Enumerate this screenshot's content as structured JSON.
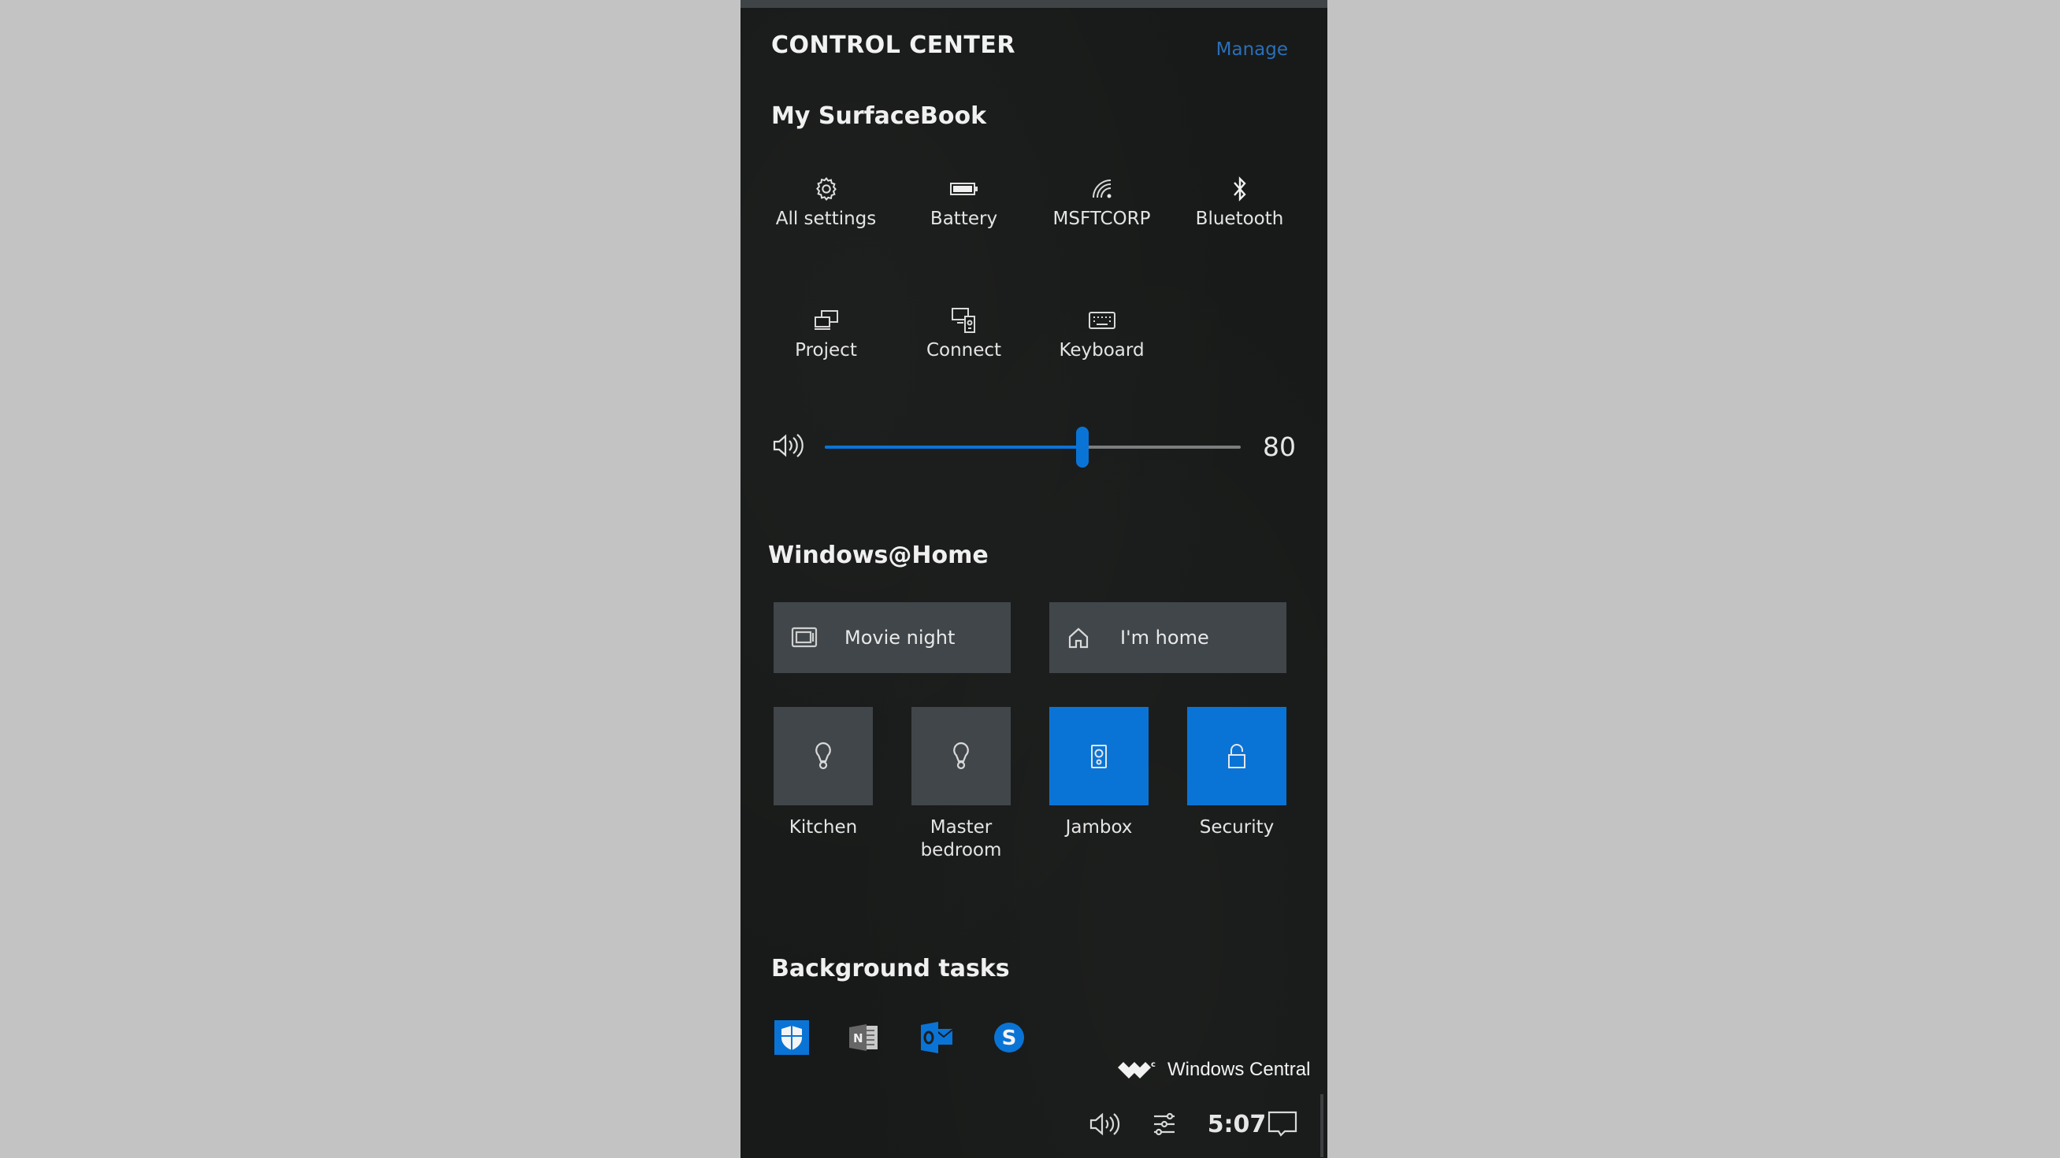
{
  "panel": {
    "title": "CONTROL CENTER",
    "manage_label": "Manage"
  },
  "device_section": {
    "heading": "My SurfaceBook",
    "quick_actions": [
      {
        "label": "All settings",
        "icon": "gear-icon"
      },
      {
        "label": "Battery",
        "icon": "battery-icon"
      },
      {
        "label": "MSFTCORP",
        "icon": "wifi-icon"
      },
      {
        "label": "Bluetooth",
        "icon": "bluetooth-icon"
      },
      {
        "label": "Project",
        "icon": "project-icon"
      },
      {
        "label": "Connect",
        "icon": "connect-icon"
      },
      {
        "label": "Keyboard",
        "icon": "keyboard-icon"
      }
    ],
    "volume": {
      "icon": "speaker-icon",
      "value_label": "80",
      "fill_fraction": 0.62
    }
  },
  "home_section": {
    "heading": "Windows@Home",
    "scenes": [
      {
        "label": "Movie night",
        "icon": "tv-icon"
      },
      {
        "label": "I'm home",
        "icon": "house-icon"
      }
    ],
    "devices": [
      {
        "label_line1": "Kitchen",
        "label_line2": "",
        "icon": "lightbulb-icon",
        "active": false
      },
      {
        "label_line1": "Master",
        "label_line2": "bedroom",
        "icon": "lightbulb-icon",
        "active": false
      },
      {
        "label_line1": "Jambox",
        "label_line2": "",
        "icon": "speaker-box-icon",
        "active": true
      },
      {
        "label_line1": "Security",
        "label_line2": "",
        "icon": "unlock-icon",
        "active": true
      }
    ],
    "colors": {
      "active": "#0a74d6",
      "inactive": "#41464a"
    }
  },
  "background_tasks": {
    "heading": "Background tasks",
    "apps": [
      {
        "name": "Windows Defender",
        "icon": "defender-shield-icon"
      },
      {
        "name": "OneNote",
        "icon": "onenote-icon"
      },
      {
        "name": "Outlook",
        "icon": "outlook-icon"
      },
      {
        "name": "Skype",
        "icon": "skype-icon"
      }
    ]
  },
  "watermark": {
    "text": "Windows Central"
  },
  "taskbar": {
    "time": "5:07",
    "icons": [
      "speaker-icon",
      "control-center-icon",
      "action-center-icon"
    ]
  },
  "colors": {
    "accent": "#0a74d6",
    "link": "#2a6fb8",
    "panel_bg": "#181a19"
  }
}
